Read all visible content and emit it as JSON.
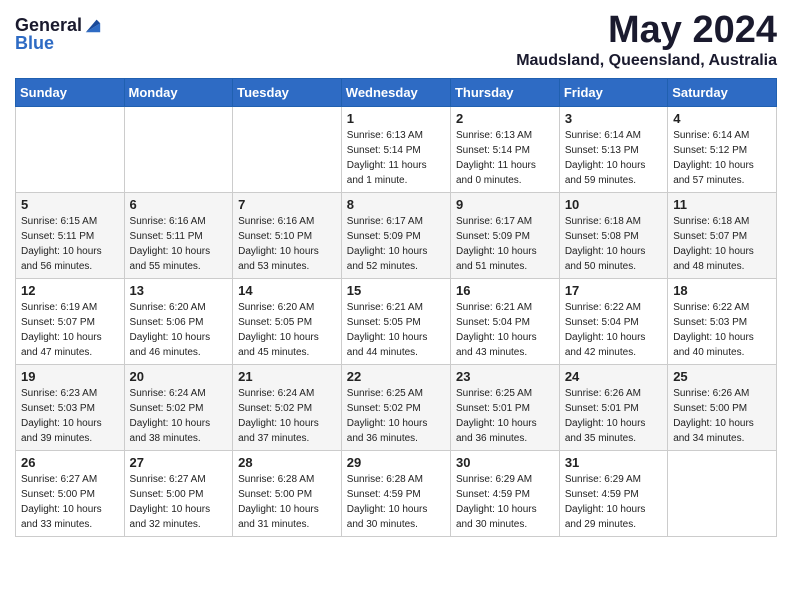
{
  "header": {
    "logo_general": "General",
    "logo_blue": "Blue",
    "month_year": "May 2024",
    "location": "Maudsland, Queensland, Australia"
  },
  "days_of_week": [
    "Sunday",
    "Monday",
    "Tuesday",
    "Wednesday",
    "Thursday",
    "Friday",
    "Saturday"
  ],
  "weeks": [
    [
      {
        "day": "",
        "sunrise": "",
        "sunset": "",
        "daylight": ""
      },
      {
        "day": "",
        "sunrise": "",
        "sunset": "",
        "daylight": ""
      },
      {
        "day": "",
        "sunrise": "",
        "sunset": "",
        "daylight": ""
      },
      {
        "day": "1",
        "sunrise": "Sunrise: 6:13 AM",
        "sunset": "Sunset: 5:14 PM",
        "daylight": "Daylight: 11 hours and 1 minute."
      },
      {
        "day": "2",
        "sunrise": "Sunrise: 6:13 AM",
        "sunset": "Sunset: 5:14 PM",
        "daylight": "Daylight: 11 hours and 0 minutes."
      },
      {
        "day": "3",
        "sunrise": "Sunrise: 6:14 AM",
        "sunset": "Sunset: 5:13 PM",
        "daylight": "Daylight: 10 hours and 59 minutes."
      },
      {
        "day": "4",
        "sunrise": "Sunrise: 6:14 AM",
        "sunset": "Sunset: 5:12 PM",
        "daylight": "Daylight: 10 hours and 57 minutes."
      }
    ],
    [
      {
        "day": "5",
        "sunrise": "Sunrise: 6:15 AM",
        "sunset": "Sunset: 5:11 PM",
        "daylight": "Daylight: 10 hours and 56 minutes."
      },
      {
        "day": "6",
        "sunrise": "Sunrise: 6:16 AM",
        "sunset": "Sunset: 5:11 PM",
        "daylight": "Daylight: 10 hours and 55 minutes."
      },
      {
        "day": "7",
        "sunrise": "Sunrise: 6:16 AM",
        "sunset": "Sunset: 5:10 PM",
        "daylight": "Daylight: 10 hours and 53 minutes."
      },
      {
        "day": "8",
        "sunrise": "Sunrise: 6:17 AM",
        "sunset": "Sunset: 5:09 PM",
        "daylight": "Daylight: 10 hours and 52 minutes."
      },
      {
        "day": "9",
        "sunrise": "Sunrise: 6:17 AM",
        "sunset": "Sunset: 5:09 PM",
        "daylight": "Daylight: 10 hours and 51 minutes."
      },
      {
        "day": "10",
        "sunrise": "Sunrise: 6:18 AM",
        "sunset": "Sunset: 5:08 PM",
        "daylight": "Daylight: 10 hours and 50 minutes."
      },
      {
        "day": "11",
        "sunrise": "Sunrise: 6:18 AM",
        "sunset": "Sunset: 5:07 PM",
        "daylight": "Daylight: 10 hours and 48 minutes."
      }
    ],
    [
      {
        "day": "12",
        "sunrise": "Sunrise: 6:19 AM",
        "sunset": "Sunset: 5:07 PM",
        "daylight": "Daylight: 10 hours and 47 minutes."
      },
      {
        "day": "13",
        "sunrise": "Sunrise: 6:20 AM",
        "sunset": "Sunset: 5:06 PM",
        "daylight": "Daylight: 10 hours and 46 minutes."
      },
      {
        "day": "14",
        "sunrise": "Sunrise: 6:20 AM",
        "sunset": "Sunset: 5:05 PM",
        "daylight": "Daylight: 10 hours and 45 minutes."
      },
      {
        "day": "15",
        "sunrise": "Sunrise: 6:21 AM",
        "sunset": "Sunset: 5:05 PM",
        "daylight": "Daylight: 10 hours and 44 minutes."
      },
      {
        "day": "16",
        "sunrise": "Sunrise: 6:21 AM",
        "sunset": "Sunset: 5:04 PM",
        "daylight": "Daylight: 10 hours and 43 minutes."
      },
      {
        "day": "17",
        "sunrise": "Sunrise: 6:22 AM",
        "sunset": "Sunset: 5:04 PM",
        "daylight": "Daylight: 10 hours and 42 minutes."
      },
      {
        "day": "18",
        "sunrise": "Sunrise: 6:22 AM",
        "sunset": "Sunset: 5:03 PM",
        "daylight": "Daylight: 10 hours and 40 minutes."
      }
    ],
    [
      {
        "day": "19",
        "sunrise": "Sunrise: 6:23 AM",
        "sunset": "Sunset: 5:03 PM",
        "daylight": "Daylight: 10 hours and 39 minutes."
      },
      {
        "day": "20",
        "sunrise": "Sunrise: 6:24 AM",
        "sunset": "Sunset: 5:02 PM",
        "daylight": "Daylight: 10 hours and 38 minutes."
      },
      {
        "day": "21",
        "sunrise": "Sunrise: 6:24 AM",
        "sunset": "Sunset: 5:02 PM",
        "daylight": "Daylight: 10 hours and 37 minutes."
      },
      {
        "day": "22",
        "sunrise": "Sunrise: 6:25 AM",
        "sunset": "Sunset: 5:02 PM",
        "daylight": "Daylight: 10 hours and 36 minutes."
      },
      {
        "day": "23",
        "sunrise": "Sunrise: 6:25 AM",
        "sunset": "Sunset: 5:01 PM",
        "daylight": "Daylight: 10 hours and 36 minutes."
      },
      {
        "day": "24",
        "sunrise": "Sunrise: 6:26 AM",
        "sunset": "Sunset: 5:01 PM",
        "daylight": "Daylight: 10 hours and 35 minutes."
      },
      {
        "day": "25",
        "sunrise": "Sunrise: 6:26 AM",
        "sunset": "Sunset: 5:00 PM",
        "daylight": "Daylight: 10 hours and 34 minutes."
      }
    ],
    [
      {
        "day": "26",
        "sunrise": "Sunrise: 6:27 AM",
        "sunset": "Sunset: 5:00 PM",
        "daylight": "Daylight: 10 hours and 33 minutes."
      },
      {
        "day": "27",
        "sunrise": "Sunrise: 6:27 AM",
        "sunset": "Sunset: 5:00 PM",
        "daylight": "Daylight: 10 hours and 32 minutes."
      },
      {
        "day": "28",
        "sunrise": "Sunrise: 6:28 AM",
        "sunset": "Sunset: 5:00 PM",
        "daylight": "Daylight: 10 hours and 31 minutes."
      },
      {
        "day": "29",
        "sunrise": "Sunrise: 6:28 AM",
        "sunset": "Sunset: 4:59 PM",
        "daylight": "Daylight: 10 hours and 30 minutes."
      },
      {
        "day": "30",
        "sunrise": "Sunrise: 6:29 AM",
        "sunset": "Sunset: 4:59 PM",
        "daylight": "Daylight: 10 hours and 30 minutes."
      },
      {
        "day": "31",
        "sunrise": "Sunrise: 6:29 AM",
        "sunset": "Sunset: 4:59 PM",
        "daylight": "Daylight: 10 hours and 29 minutes."
      },
      {
        "day": "",
        "sunrise": "",
        "sunset": "",
        "daylight": ""
      }
    ]
  ]
}
